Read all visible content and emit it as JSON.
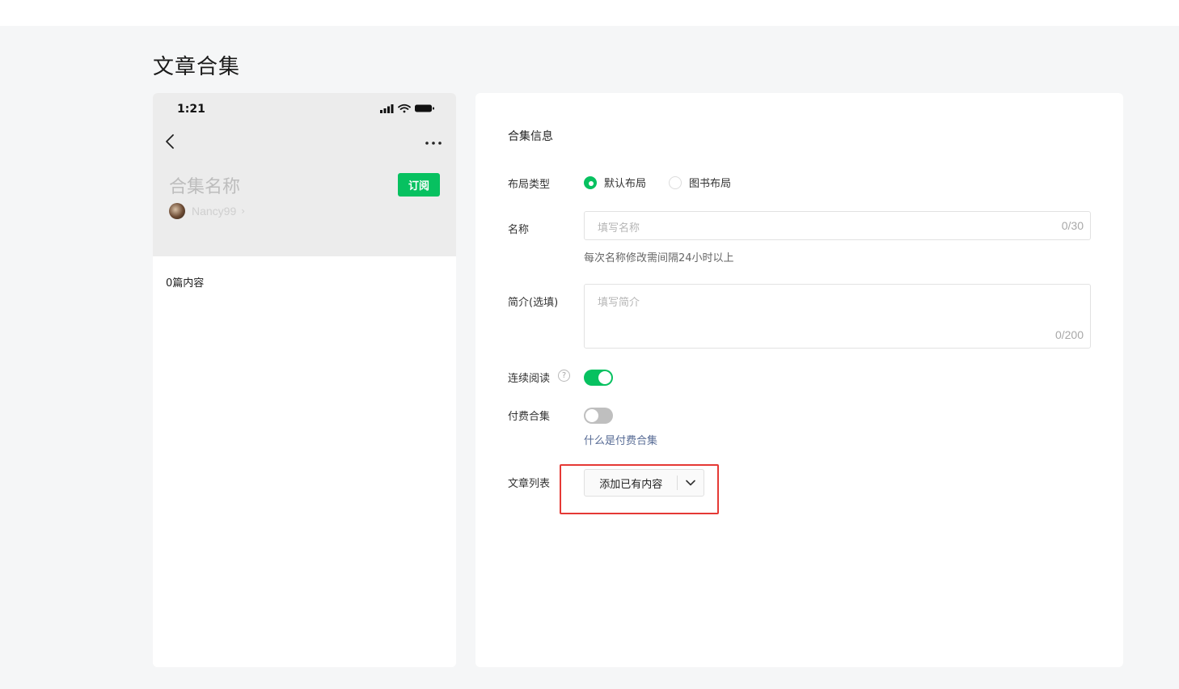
{
  "page": {
    "title": "文章合集"
  },
  "preview": {
    "status_time": "1:21",
    "collection_name": "合集名称",
    "subscribe_label": "订阅",
    "author_name": "Nancy99",
    "author_chevron": "›",
    "content_count": "0篇内容"
  },
  "form": {
    "section_title": "合集信息",
    "layout": {
      "label": "布局类型",
      "options": [
        {
          "label": "默认布局",
          "selected": true
        },
        {
          "label": "图书布局",
          "selected": false
        }
      ]
    },
    "name": {
      "label": "名称",
      "placeholder": "填写名称",
      "counter": "0/30",
      "hint": "每次名称修改需间隔24小时以上"
    },
    "intro": {
      "label": "简介(选填)",
      "placeholder": "填写简介",
      "counter": "0/200"
    },
    "continuous_reading": {
      "label": "连续阅读",
      "help": "?",
      "enabled": true
    },
    "paid_collection": {
      "label": "付费合集",
      "enabled": false,
      "link": "什么是付费合集"
    },
    "article_list": {
      "label": "文章列表",
      "add_button": "添加已有内容"
    }
  },
  "colors": {
    "accent": "#07c160",
    "highlight": "#e53935",
    "link": "#576b95"
  }
}
